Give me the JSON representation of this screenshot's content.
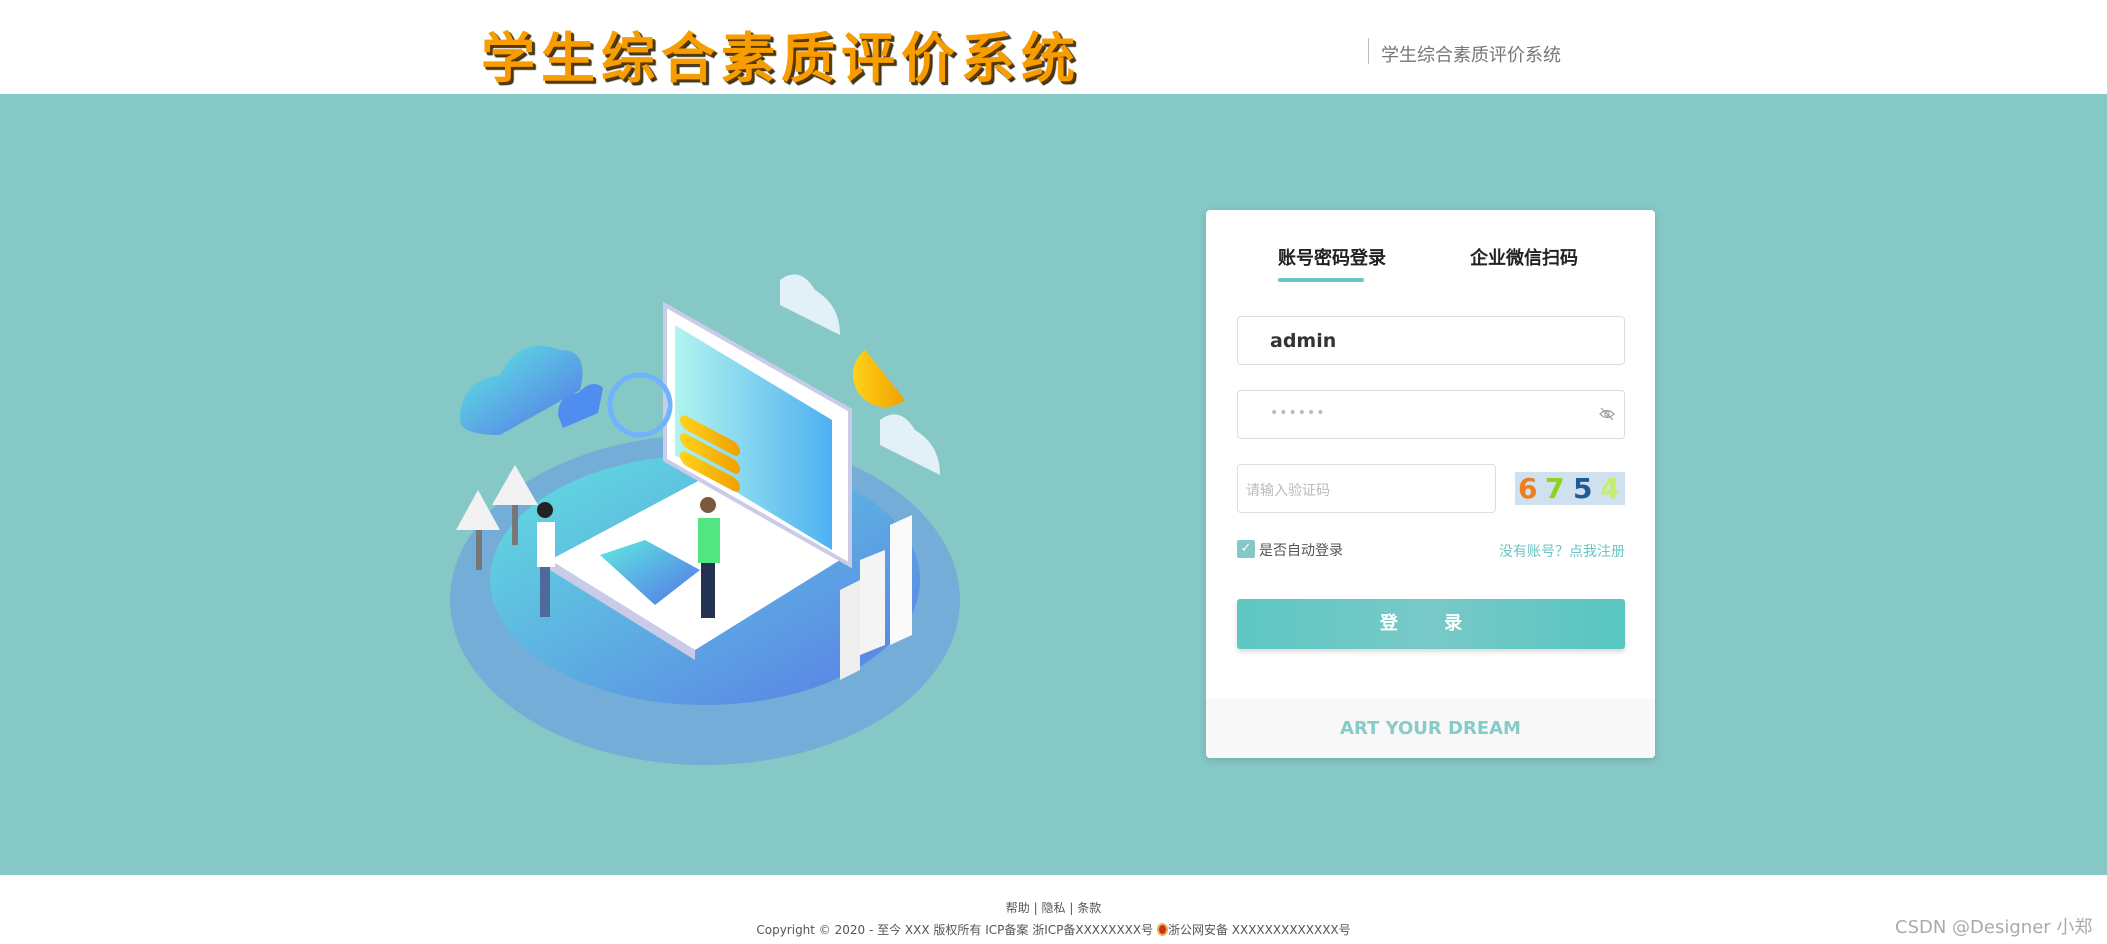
{
  "header": {
    "logo_text": "学生综合素质评价系统",
    "subtitle": "学生综合素质评价系统"
  },
  "login": {
    "tabs": [
      {
        "label": "账号密码登录",
        "active": true
      },
      {
        "label": "企业微信扫码",
        "active": false
      }
    ],
    "username": {
      "value": "admin"
    },
    "password": {
      "value": "••••••"
    },
    "captcha": {
      "placeholder": "请输入验证码",
      "code": [
        "6",
        "7",
        "5",
        "4"
      ],
      "colors": [
        "#f07d1c",
        "#8ed11f",
        "#1e5b96",
        "#c7ee6a"
      ]
    },
    "remember": {
      "label": "是否自动登录",
      "checked": true
    },
    "register_link": "没有账号？点我注册",
    "submit_label": "登 录",
    "footer_slogan": "ART YOUR DREAM"
  },
  "footer": {
    "links": [
      "帮助",
      "隐私",
      "条款"
    ],
    "separator": "|",
    "copyright": "Copyright © 2020 - 至今 XXX 版权所有 ICP备案 浙ICP备XXXXXXXX号",
    "police": "浙公网安备 XXXXXXXXXXXXX号"
  },
  "watermark": "CSDN @Designer 小郑",
  "colors": {
    "primary": "#6cc5c3",
    "background": "#85c8c6",
    "logo": "#f89d00"
  }
}
